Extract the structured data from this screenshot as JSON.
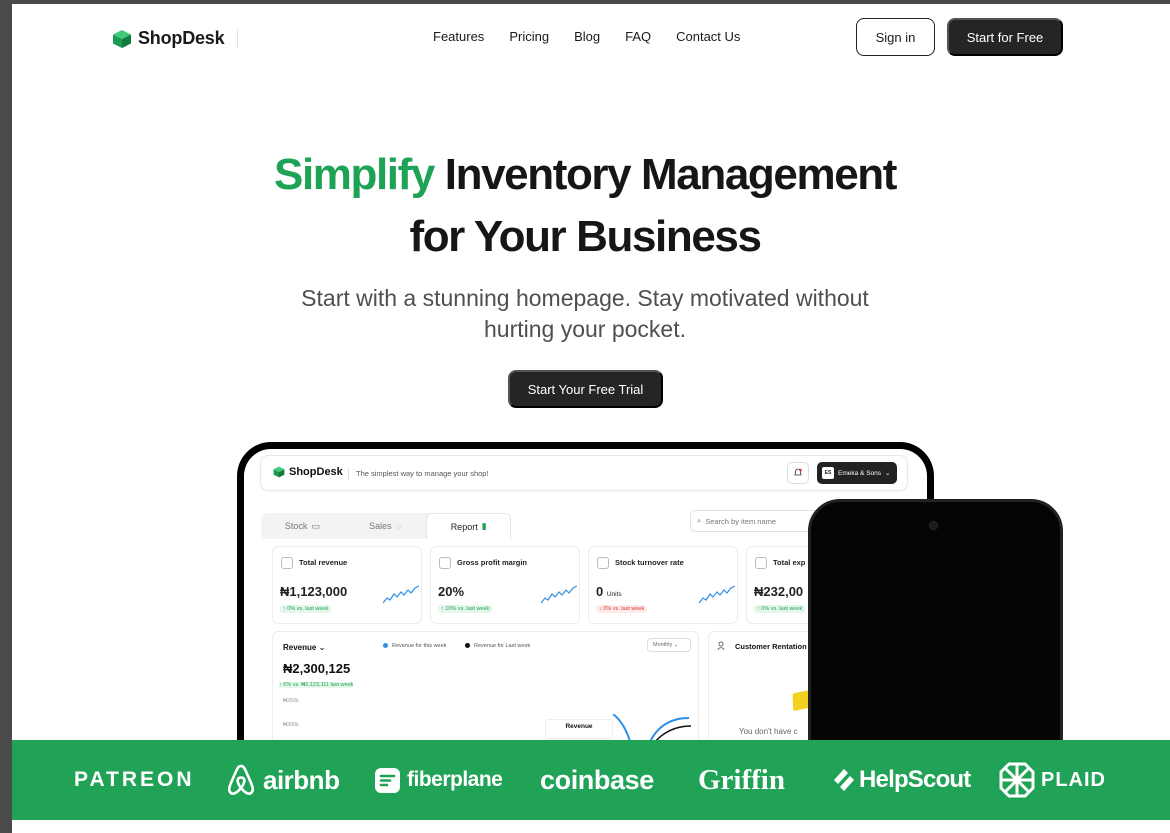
{
  "brand": {
    "name": "ShopDesk",
    "green": "#1ea356",
    "dark": "#252525"
  },
  "nav": {
    "links": [
      "Features",
      "Pricing",
      "Blog",
      "FAQ",
      "Contact Us"
    ],
    "signin": "Sign in",
    "start": "Start for Free"
  },
  "hero": {
    "title_highlight": "Simplify",
    "title_rest_line1": "Inventory Management",
    "title_line2": "for Your Business",
    "subtitle_line1": "Start with a stunning homepage. Stay motivated without",
    "subtitle_line2": "hurting your pocket.",
    "cta": "Start Your Free Trial"
  },
  "dashboard": {
    "logo": "ShopDesk",
    "tagline": "The simplest way to manage your shop!",
    "user_initials": "ES",
    "user_name": "Emeka & Sons",
    "tabs": [
      "Stock",
      "Sales",
      "Report"
    ],
    "search_placeholder": "Search by item name",
    "cards": [
      {
        "label": "Total revenue",
        "value": "₦1,123,000",
        "unit": "",
        "change": "↑ 0% vs. last week",
        "dir": "up"
      },
      {
        "label": "Gross profit margin",
        "value": "20%",
        "unit": "",
        "change": "↑ 10% vs. last week",
        "dir": "up"
      },
      {
        "label": "Stock turnover rate",
        "value": "0",
        "unit": "Units",
        "change": "↓ 0% vs. last week",
        "dir": "down"
      },
      {
        "label": "Total exp",
        "value": "₦232,00",
        "unit": "",
        "change": "↑ 0% vs. last week",
        "dir": "up"
      }
    ],
    "revenue": {
      "title": "Revenue ⌄",
      "legend_this": "Revenue for this week",
      "legend_last": "Revenue for Last week",
      "period": "Monthly ⌄",
      "value": "₦2,300,125",
      "change": "↑ 6% vs. ₦2,123,111 last week",
      "y_ticks": [
        "₦250k",
        "₦200k"
      ],
      "tooltip": "Revenue"
    },
    "customer": {
      "title": "Customer Rentation",
      "empty": "You don't have c"
    }
  },
  "logos": [
    "PATREON",
    "airbnb",
    "fiberplane",
    "coinbase",
    "Griffin",
    "HelpScout",
    "PLAID"
  ]
}
